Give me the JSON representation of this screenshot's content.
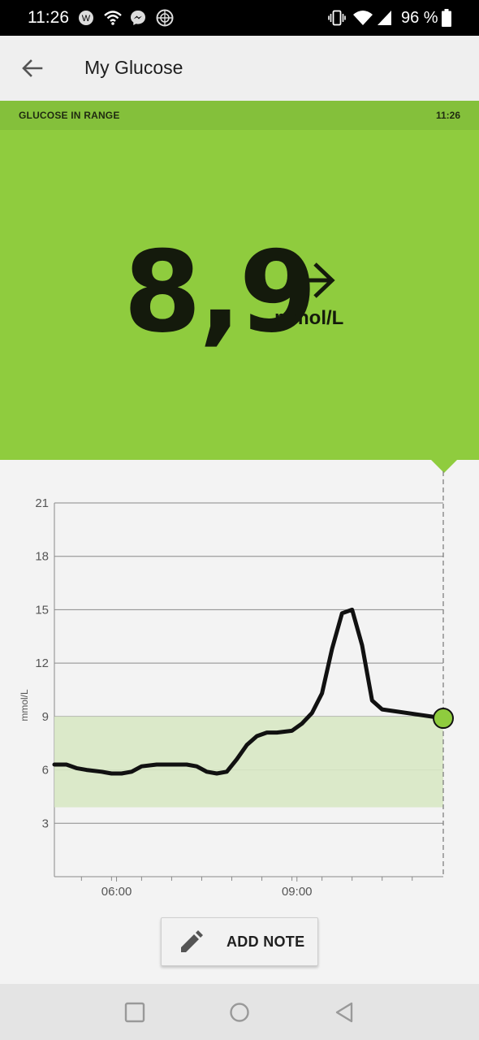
{
  "status_bar": {
    "time": "11:26",
    "battery": "96 %",
    "icons": [
      "app-w-icon",
      "wifi-icon",
      "messenger-icon",
      "globe-icon",
      "vibrate-icon",
      "wifi-signal-icon",
      "cell-signal-icon",
      "battery-icon"
    ]
  },
  "app_bar": {
    "title": "My Glucose",
    "back_icon": "arrow-left-icon"
  },
  "range_strip": {
    "label": "GLUCOSE IN RANGE",
    "time": "11:26",
    "color": "#84c03b"
  },
  "reading": {
    "value": "8,9",
    "unit": "mmol/L",
    "trend_icon": "arrow-right-icon",
    "background_color": "#8fcc3e"
  },
  "chart_data": {
    "type": "line",
    "ylabel": "mmol/L",
    "ylim": [
      0,
      21
    ],
    "yticks": [
      3,
      6,
      9,
      12,
      15,
      18,
      21
    ],
    "xlim": [
      "04:58",
      "11:26"
    ],
    "xtick_labels": [
      {
        "t": "06:00",
        "label": "06:00"
      },
      {
        "t": "09:00",
        "label": "09:00"
      }
    ],
    "minor_ticks": [
      "05:25",
      "05:55",
      "06:25",
      "06:55",
      "07:25",
      "07:55",
      "08:25",
      "08:55",
      "09:25",
      "09:55",
      "10:25",
      "10:55"
    ],
    "target_range": [
      3.9,
      9.0
    ],
    "target_range_color": "#d8e8c4",
    "line_color": "#111111",
    "current_marker_color": "#8fcc3e",
    "series": [
      {
        "values": [
          [
            "04:58",
            6.3
          ],
          [
            "05:10",
            6.3
          ],
          [
            "05:20",
            6.1
          ],
          [
            "05:30",
            6.0
          ],
          [
            "05:45",
            5.9
          ],
          [
            "05:55",
            5.8
          ],
          [
            "06:05",
            5.8
          ],
          [
            "06:15",
            5.9
          ],
          [
            "06:25",
            6.2
          ],
          [
            "06:40",
            6.3
          ],
          [
            "06:55",
            6.3
          ],
          [
            "07:10",
            6.3
          ],
          [
            "07:20",
            6.2
          ],
          [
            "07:30",
            5.9
          ],
          [
            "07:40",
            5.8
          ],
          [
            "07:50",
            5.9
          ],
          [
            "08:00",
            6.6
          ],
          [
            "08:10",
            7.4
          ],
          [
            "08:20",
            7.9
          ],
          [
            "08:30",
            8.1
          ],
          [
            "08:40",
            8.1
          ],
          [
            "08:55",
            8.2
          ],
          [
            "09:05",
            8.6
          ],
          [
            "09:15",
            9.2
          ],
          [
            "09:25",
            10.3
          ],
          [
            "09:35",
            12.8
          ],
          [
            "09:45",
            14.8
          ],
          [
            "09:55",
            15.0
          ],
          [
            "10:05",
            13.0
          ],
          [
            "10:15",
            9.9
          ],
          [
            "10:25",
            9.4
          ],
          [
            "11:26",
            8.9
          ]
        ]
      }
    ]
  },
  "add_note": {
    "label": "ADD NOTE",
    "icon": "pencil-icon"
  },
  "nav_bar": {
    "icons": [
      "recents-square-icon",
      "home-circle-icon",
      "back-triangle-icon"
    ]
  }
}
